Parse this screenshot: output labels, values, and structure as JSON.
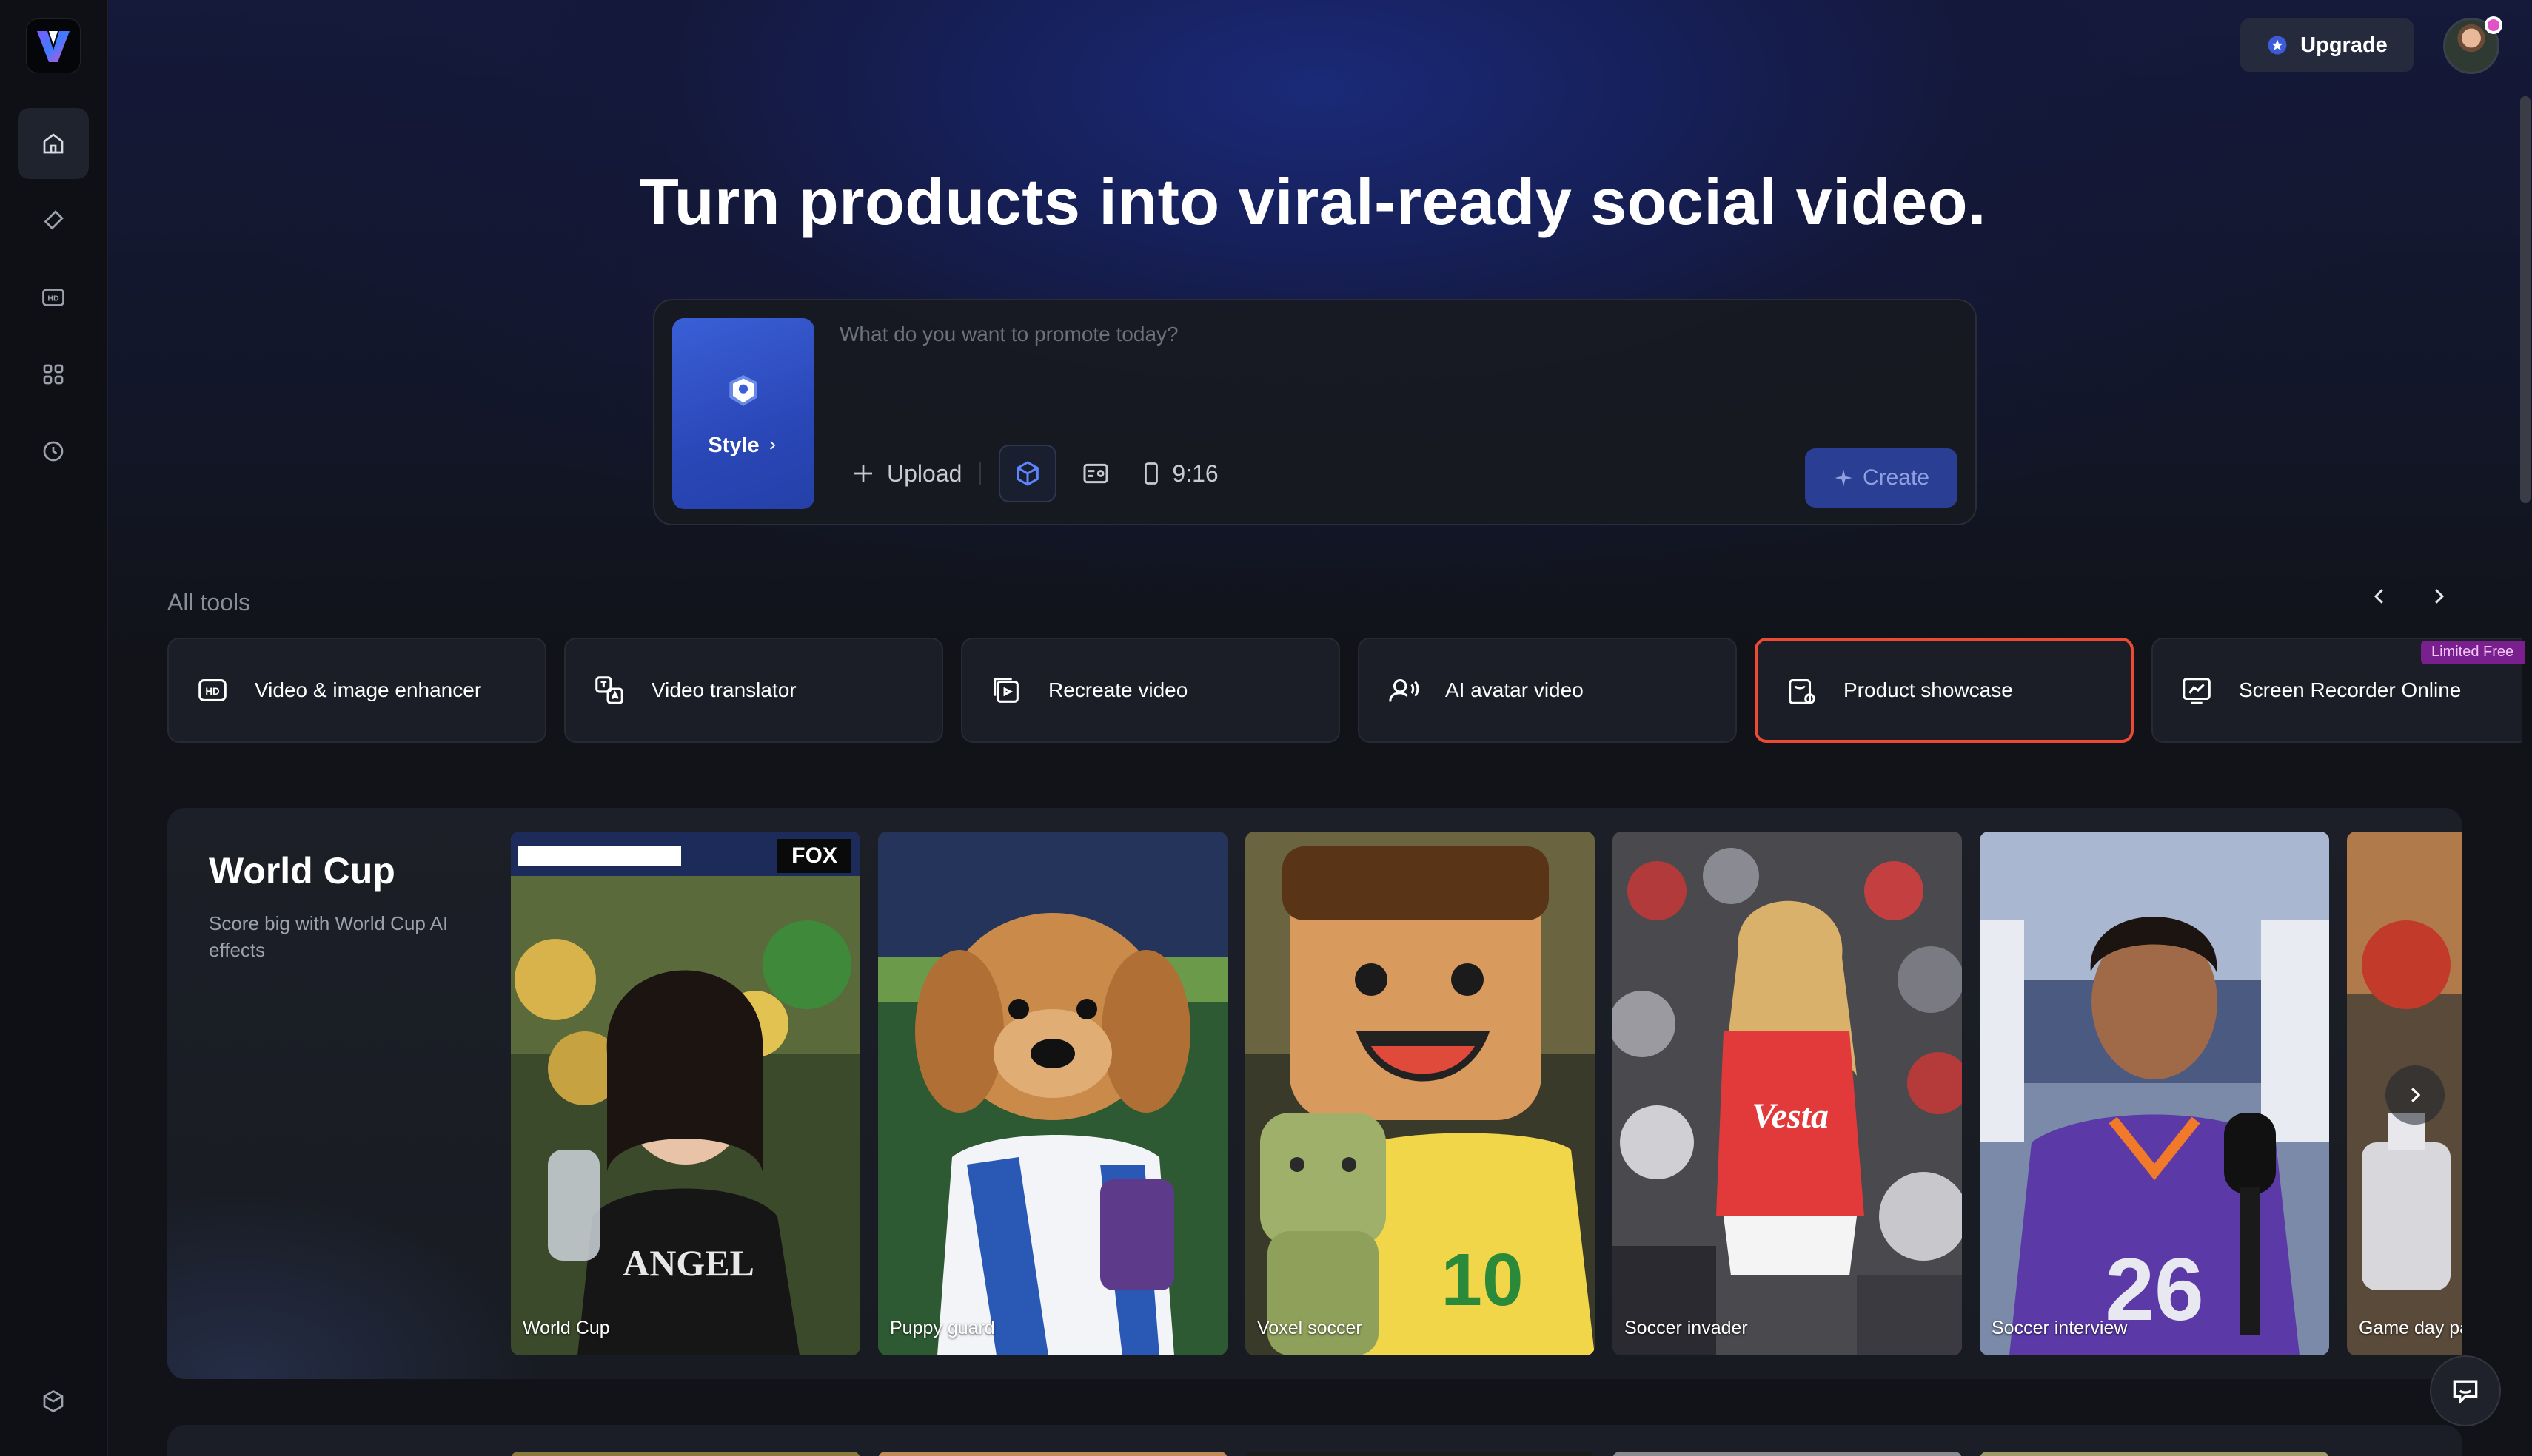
{
  "hero": {
    "title": "Turn products into viral-ready social video.",
    "prompt_placeholder": "What do you want to promote today?",
    "style_label": "Style",
    "upload_label": "Upload",
    "ratio_label": "9:16",
    "create_label": "Create"
  },
  "header": {
    "upgrade_label": "Upgrade"
  },
  "sidebar": {
    "items": [
      {
        "name": "home-icon",
        "active": true
      },
      {
        "name": "eraser-icon",
        "active": false
      },
      {
        "name": "hd-icon",
        "active": false
      },
      {
        "name": "apps-grid-icon",
        "active": false
      },
      {
        "name": "history-clock-icon",
        "active": false
      }
    ],
    "bottom_icon": "package-icon"
  },
  "tools": {
    "header": "All tools",
    "items": [
      {
        "label": "Video & image enhancer",
        "icon": "hd-icon",
        "selected": false
      },
      {
        "label": "Video translator",
        "icon": "translate-icon",
        "selected": false
      },
      {
        "label": "Recreate video",
        "icon": "recreate-icon",
        "selected": false
      },
      {
        "label": "AI avatar video",
        "icon": "avatar-icon",
        "selected": false
      },
      {
        "label": "Product showcase",
        "icon": "product-icon",
        "selected": true
      },
      {
        "label": "Screen Recorder Online",
        "icon": "screen-record-icon",
        "selected": false
      }
    ],
    "badge": "Limited Free"
  },
  "section": {
    "title": "World Cup",
    "description": "Score big with World Cup AI effects",
    "thumbnails": [
      {
        "label": "World Cup"
      },
      {
        "label": "Puppy guard"
      },
      {
        "label": "Voxel soccer"
      },
      {
        "label": "Soccer invader"
      },
      {
        "label": "Soccer interview"
      },
      {
        "label": "Game day pa"
      }
    ]
  },
  "colors": {
    "accent": "#2a47b8",
    "selected_border": "#ec4a33",
    "badge": "#7a1f8e"
  }
}
